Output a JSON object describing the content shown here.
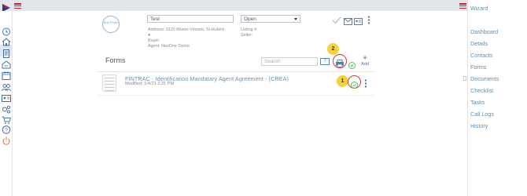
{
  "app": {
    "brand_color": "#c0262d",
    "accent": "#3d6ea5"
  },
  "left_sidebar": {
    "icons": [
      "clock-icon",
      "home-icon",
      "document-icon",
      "open-house-icon",
      "calendar-icon",
      "group-icon",
      "contact-card-icon",
      "settings-icon",
      "cart-icon",
      "help-icon",
      "power-icon"
    ]
  },
  "right_nav": {
    "items": [
      "Wizard",
      "Dashboard",
      "Details",
      "Contacts",
      "Forms",
      "Documents",
      "Checklist",
      "Tasks",
      "Call Logs",
      "History"
    ]
  },
  "header": {
    "photo_label": "Add Photo",
    "name_value": "Test",
    "status_value": "Open",
    "address": "Address: 3120 Morse-Vincent, St-Hubert",
    "listing": "Listing #:",
    "buyer": "Buyer:",
    "seller": "Seller:",
    "agent": "Agent: NexOne Demo"
  },
  "forms": {
    "title": "Forms",
    "search_placeholder": "Search",
    "help_label": "?",
    "add_label": "Add",
    "callout_1": "1",
    "callout_2": "2",
    "items": [
      {
        "title": "FINTRAC - Identification Mandatary Agent Agreement - (CREA)",
        "modified": "Modified: 1/4/21 2:31 PM"
      }
    ]
  }
}
